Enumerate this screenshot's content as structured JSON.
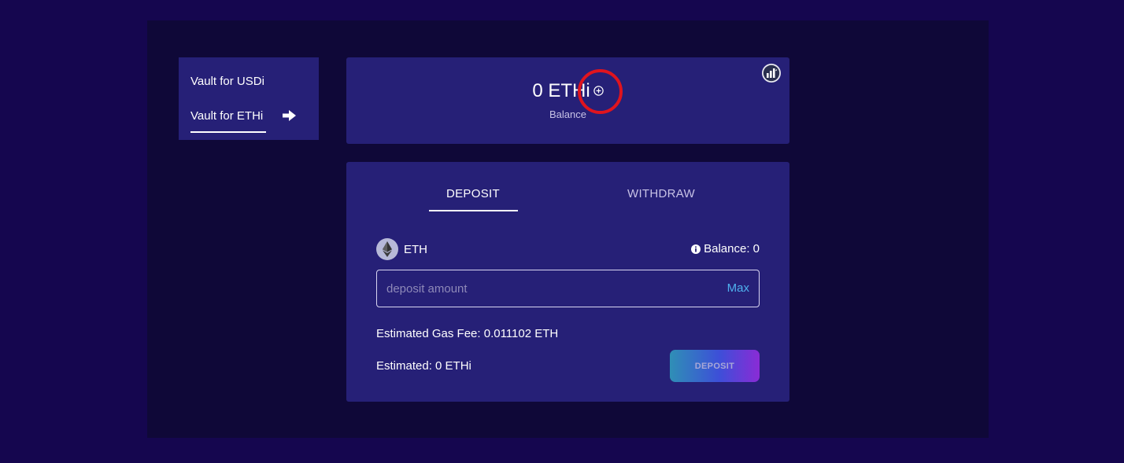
{
  "sidebar": {
    "items": [
      {
        "label": "Vault for USDi"
      },
      {
        "label": "Vault for ETHi"
      }
    ],
    "active_icon": "arrow-right-icon"
  },
  "balance_card": {
    "amount": "0 ETHi",
    "label": "Balance",
    "add_icon": "plus-circle-icon",
    "chart_icon": "bar-chart-icon",
    "highlight_color": "#e0141e"
  },
  "action_card": {
    "tabs": [
      {
        "label": "DEPOSIT",
        "active": true
      },
      {
        "label": "WITHDRAW",
        "active": false
      }
    ],
    "token": {
      "name": "ETH",
      "icon": "ethereum-icon"
    },
    "balance_text": "Balance: 0",
    "input": {
      "placeholder": "deposit amount",
      "value": ""
    },
    "max_label": "Max",
    "gas_fee": "Estimated Gas Fee:  0.011102 ETH",
    "estimated": "Estimated:  0 ETHi",
    "deposit_button": "DEPOSIT"
  },
  "colors": {
    "background": "#15064f",
    "panel": "#0f0838",
    "card": "#262077",
    "accent": "#4fb0ee"
  }
}
